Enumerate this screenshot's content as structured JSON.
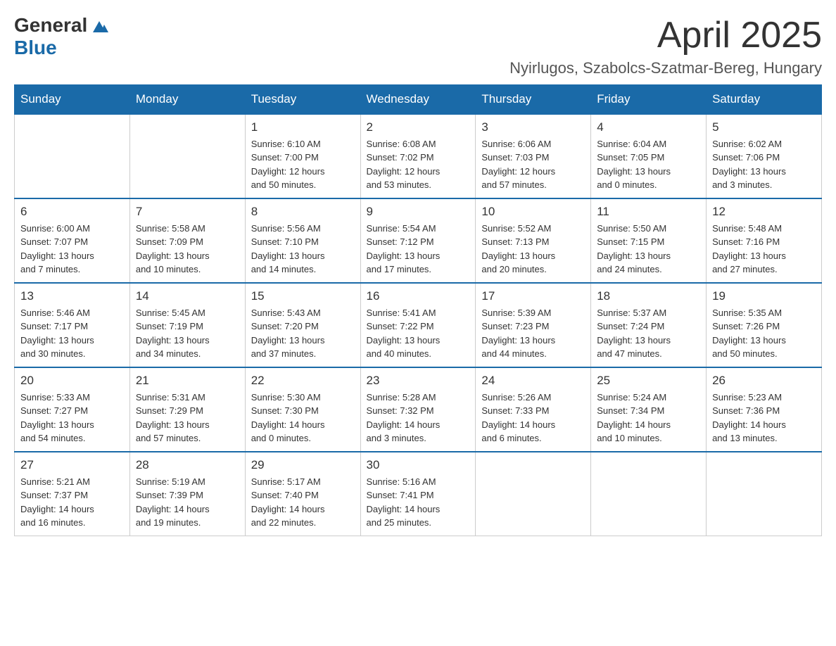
{
  "header": {
    "logo_general": "General",
    "logo_blue": "Blue",
    "month_year": "April 2025",
    "location": "Nyirlugos, Szabolcs-Szatmar-Bereg, Hungary"
  },
  "weekdays": [
    "Sunday",
    "Monday",
    "Tuesday",
    "Wednesday",
    "Thursday",
    "Friday",
    "Saturday"
  ],
  "weeks": [
    [
      {
        "day": "",
        "info": ""
      },
      {
        "day": "",
        "info": ""
      },
      {
        "day": "1",
        "info": "Sunrise: 6:10 AM\nSunset: 7:00 PM\nDaylight: 12 hours\nand 50 minutes."
      },
      {
        "day": "2",
        "info": "Sunrise: 6:08 AM\nSunset: 7:02 PM\nDaylight: 12 hours\nand 53 minutes."
      },
      {
        "day": "3",
        "info": "Sunrise: 6:06 AM\nSunset: 7:03 PM\nDaylight: 12 hours\nand 57 minutes."
      },
      {
        "day": "4",
        "info": "Sunrise: 6:04 AM\nSunset: 7:05 PM\nDaylight: 13 hours\nand 0 minutes."
      },
      {
        "day": "5",
        "info": "Sunrise: 6:02 AM\nSunset: 7:06 PM\nDaylight: 13 hours\nand 3 minutes."
      }
    ],
    [
      {
        "day": "6",
        "info": "Sunrise: 6:00 AM\nSunset: 7:07 PM\nDaylight: 13 hours\nand 7 minutes."
      },
      {
        "day": "7",
        "info": "Sunrise: 5:58 AM\nSunset: 7:09 PM\nDaylight: 13 hours\nand 10 minutes."
      },
      {
        "day": "8",
        "info": "Sunrise: 5:56 AM\nSunset: 7:10 PM\nDaylight: 13 hours\nand 14 minutes."
      },
      {
        "day": "9",
        "info": "Sunrise: 5:54 AM\nSunset: 7:12 PM\nDaylight: 13 hours\nand 17 minutes."
      },
      {
        "day": "10",
        "info": "Sunrise: 5:52 AM\nSunset: 7:13 PM\nDaylight: 13 hours\nand 20 minutes."
      },
      {
        "day": "11",
        "info": "Sunrise: 5:50 AM\nSunset: 7:15 PM\nDaylight: 13 hours\nand 24 minutes."
      },
      {
        "day": "12",
        "info": "Sunrise: 5:48 AM\nSunset: 7:16 PM\nDaylight: 13 hours\nand 27 minutes."
      }
    ],
    [
      {
        "day": "13",
        "info": "Sunrise: 5:46 AM\nSunset: 7:17 PM\nDaylight: 13 hours\nand 30 minutes."
      },
      {
        "day": "14",
        "info": "Sunrise: 5:45 AM\nSunset: 7:19 PM\nDaylight: 13 hours\nand 34 minutes."
      },
      {
        "day": "15",
        "info": "Sunrise: 5:43 AM\nSunset: 7:20 PM\nDaylight: 13 hours\nand 37 minutes."
      },
      {
        "day": "16",
        "info": "Sunrise: 5:41 AM\nSunset: 7:22 PM\nDaylight: 13 hours\nand 40 minutes."
      },
      {
        "day": "17",
        "info": "Sunrise: 5:39 AM\nSunset: 7:23 PM\nDaylight: 13 hours\nand 44 minutes."
      },
      {
        "day": "18",
        "info": "Sunrise: 5:37 AM\nSunset: 7:24 PM\nDaylight: 13 hours\nand 47 minutes."
      },
      {
        "day": "19",
        "info": "Sunrise: 5:35 AM\nSunset: 7:26 PM\nDaylight: 13 hours\nand 50 minutes."
      }
    ],
    [
      {
        "day": "20",
        "info": "Sunrise: 5:33 AM\nSunset: 7:27 PM\nDaylight: 13 hours\nand 54 minutes."
      },
      {
        "day": "21",
        "info": "Sunrise: 5:31 AM\nSunset: 7:29 PM\nDaylight: 13 hours\nand 57 minutes."
      },
      {
        "day": "22",
        "info": "Sunrise: 5:30 AM\nSunset: 7:30 PM\nDaylight: 14 hours\nand 0 minutes."
      },
      {
        "day": "23",
        "info": "Sunrise: 5:28 AM\nSunset: 7:32 PM\nDaylight: 14 hours\nand 3 minutes."
      },
      {
        "day": "24",
        "info": "Sunrise: 5:26 AM\nSunset: 7:33 PM\nDaylight: 14 hours\nand 6 minutes."
      },
      {
        "day": "25",
        "info": "Sunrise: 5:24 AM\nSunset: 7:34 PM\nDaylight: 14 hours\nand 10 minutes."
      },
      {
        "day": "26",
        "info": "Sunrise: 5:23 AM\nSunset: 7:36 PM\nDaylight: 14 hours\nand 13 minutes."
      }
    ],
    [
      {
        "day": "27",
        "info": "Sunrise: 5:21 AM\nSunset: 7:37 PM\nDaylight: 14 hours\nand 16 minutes."
      },
      {
        "day": "28",
        "info": "Sunrise: 5:19 AM\nSunset: 7:39 PM\nDaylight: 14 hours\nand 19 minutes."
      },
      {
        "day": "29",
        "info": "Sunrise: 5:17 AM\nSunset: 7:40 PM\nDaylight: 14 hours\nand 22 minutes."
      },
      {
        "day": "30",
        "info": "Sunrise: 5:16 AM\nSunset: 7:41 PM\nDaylight: 14 hours\nand 25 minutes."
      },
      {
        "day": "",
        "info": ""
      },
      {
        "day": "",
        "info": ""
      },
      {
        "day": "",
        "info": ""
      }
    ]
  ]
}
